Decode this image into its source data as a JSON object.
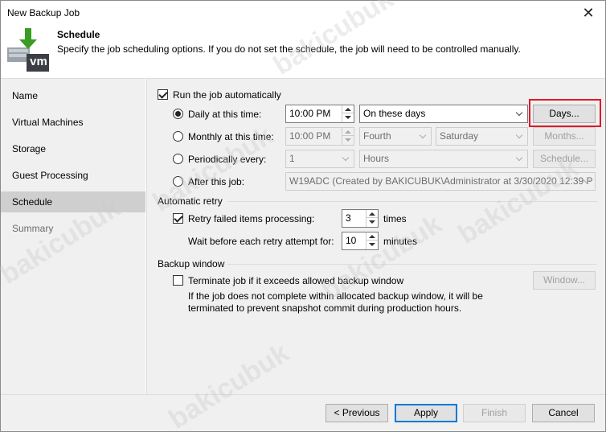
{
  "window": {
    "title": "New Backup Job",
    "close_glyph": "✕"
  },
  "header": {
    "title": "Schedule",
    "description": "Specify the job scheduling options. If you do not set the schedule, the job will need to be controlled manually.",
    "icon_label": "vm"
  },
  "sidebar": {
    "items": [
      {
        "label": "Name"
      },
      {
        "label": "Virtual Machines"
      },
      {
        "label": "Storage"
      },
      {
        "label": "Guest Processing"
      },
      {
        "label": "Schedule"
      },
      {
        "label": "Summary"
      }
    ]
  },
  "schedule": {
    "run_auto_label": "Run the job automatically",
    "daily_label": "Daily at this time:",
    "daily_time": "10:00 PM",
    "daily_days": "On these days",
    "days_button": "Days...",
    "monthly_label": "Monthly at this time:",
    "monthly_time": "10:00 PM",
    "monthly_week": "Fourth",
    "monthly_day": "Saturday",
    "months_button": "Months...",
    "periodic_label": "Periodically every:",
    "periodic_value": "1",
    "periodic_unit": "Hours",
    "schedule_button": "Schedule...",
    "after_label": "After this job:",
    "after_value": "W19ADC (Created by BAKICUBUK\\Administrator at 3/30/2020 12:39 P"
  },
  "retry": {
    "section_label": "Automatic retry",
    "retry_label": "Retry failed items processing:",
    "retry_value": "3",
    "retry_unit": "times",
    "wait_label": "Wait before each retry attempt for:",
    "wait_value": "10",
    "wait_unit": "minutes"
  },
  "backup_window": {
    "section_label": "Backup window",
    "terminate_label": "Terminate job if it exceeds allowed backup window",
    "window_button": "Window...",
    "note_line1": "If the job does not complete within allocated backup window, it will be",
    "note_line2": "terminated to prevent snapshot commit during production hours."
  },
  "footer": {
    "previous": "< Previous",
    "apply": "Apply",
    "finish": "Finish",
    "cancel": "Cancel"
  },
  "watermark": "bakicubuk",
  "colors": {
    "highlight_box": "#e0182a",
    "accent": "#0078d7",
    "icon_green": "#3a9d23"
  }
}
